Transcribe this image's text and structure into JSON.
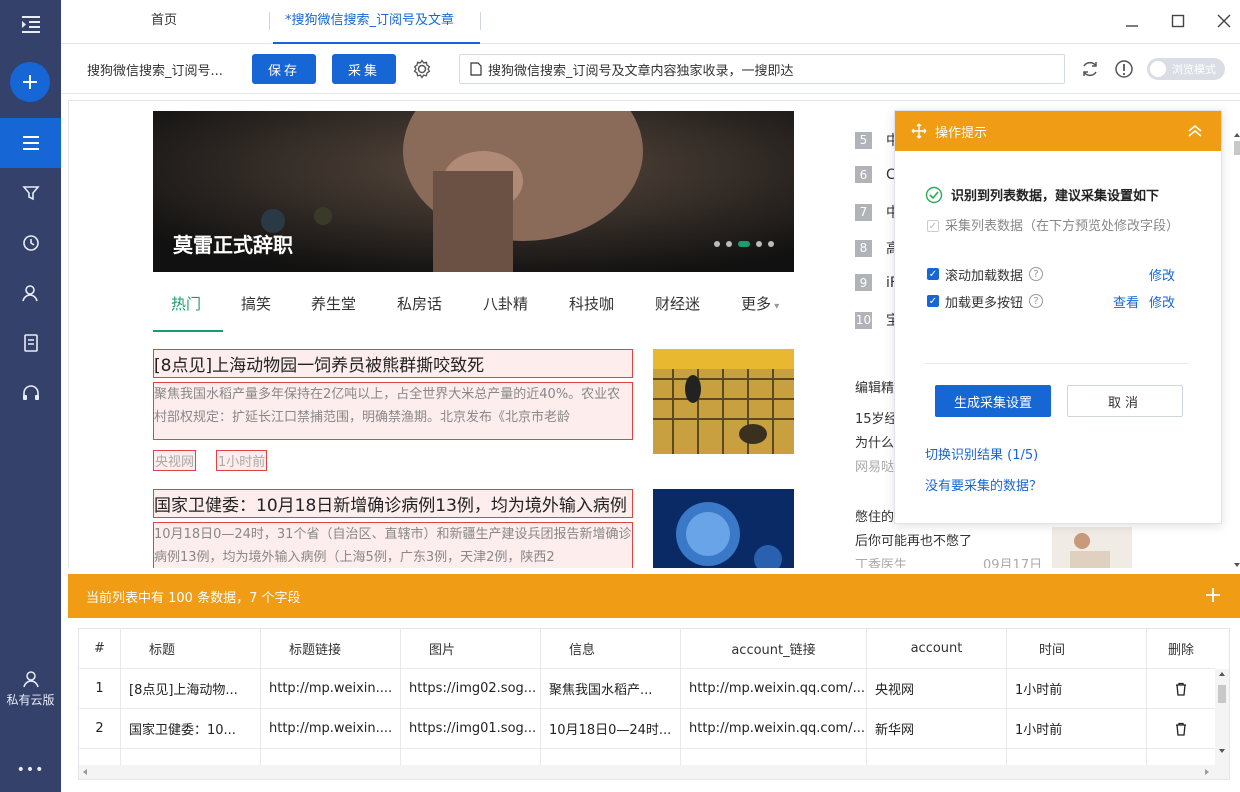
{
  "sidebar": {
    "cloud_label": "私有云版",
    "more_label": "•••"
  },
  "tabs": [
    {
      "label": "首页"
    },
    {
      "label": "*搜狗微信搜索_订阅号及文章"
    }
  ],
  "toolbar": {
    "task_title": "搜狗微信搜索_订阅号...",
    "save_label": "保存",
    "collect_label": "采集",
    "url": "搜狗微信搜索_订阅号及文章内容独家收录，一搜即达",
    "browse_mode_label": "浏览模式"
  },
  "page": {
    "banner_caption": "莫雷正式辞职",
    "nav_tabs": [
      "热门",
      "搞笑",
      "养生堂",
      "私房话",
      "八卦精",
      "科技咖",
      "财经迷",
      "更多"
    ],
    "news": [
      {
        "title": "[8点见]上海动物园一饲养员被熊群撕咬致死",
        "desc": "聚焦我国水稻产量多年保持在2亿吨以上，占全世界大米总产量的近40%。农业农村部权规定：扩延长江口禁捕范围，明确禁渔期。北京发布《北京市老龄",
        "source": "央视网",
        "time": "1小时前"
      },
      {
        "title": "国家卫健委：10月18日新增确诊病例13例，均为境外输入病例",
        "desc": "10月18日0—24时，31个省（自治区、直辖市）和新疆生产建设兵团报告新增确诊病例13例，均为境外输入病例（上海5例，广东3例，天津2例，陕西2",
        "source": "",
        "time": ""
      }
    ],
    "rank_items": [
      {
        "num": "5",
        "text": "中"
      },
      {
        "num": "6",
        "text": "C"
      },
      {
        "num": "7",
        "text": "中"
      },
      {
        "num": "8",
        "text": "高"
      },
      {
        "num": "9",
        "text": "iF"
      },
      {
        "num": "10",
        "text": "宝"
      }
    ],
    "right_block": {
      "heading": "编辑精",
      "line1": "15岁经",
      "line2": "为什么",
      "source1": "网易哒",
      "line3": "憋住的",
      "line4": "后你可能再也不憋了",
      "source2": "丁香医生",
      "date2": "09月17日"
    }
  },
  "popup": {
    "title": "操作提示",
    "message": "识别到列表数据，建议采集设置如下",
    "options": [
      {
        "label": "采集列表数据（在下方预览处修改字段）",
        "checked": true,
        "disabled": true
      },
      {
        "label": "滚动加载数据",
        "checked": true,
        "links": [
          "修改"
        ]
      },
      {
        "label": "加载更多按钮",
        "checked": true,
        "links": [
          "查看",
          "修改"
        ]
      }
    ],
    "primary_button": "生成采集设置",
    "secondary_button": "取消",
    "switch_link": "切换识别结果 (1/5)",
    "none_link": "没有要采集的数据？"
  },
  "summary": {
    "text": "当前列表中有 100 条数据，7 个字段"
  },
  "table": {
    "columns": [
      "#",
      "标题",
      "标题链接",
      "图片",
      "信息",
      "account_链接",
      "account",
      "时间",
      "删除"
    ],
    "rows": [
      [
        "1",
        "[8点见]上海动物...",
        "http://mp.weixin....",
        "https://img02.sog...",
        "聚焦我国水稻产...",
        "http://mp.weixin.qq.com/...",
        "央视网",
        "1小时前"
      ],
      [
        "2",
        "国家卫健委：10...",
        "http://mp.weixin....",
        "https://img01.sog...",
        "10月18日0—24时...",
        "http://mp.weixin.qq.com/...",
        "新华网",
        "1小时前"
      ]
    ]
  },
  "colors": {
    "sidebar": "#33416b",
    "accent_blue": "#1766d6",
    "orange": "#f09c14",
    "green": "#1b9e6b",
    "highlight_red": "#e04343"
  }
}
